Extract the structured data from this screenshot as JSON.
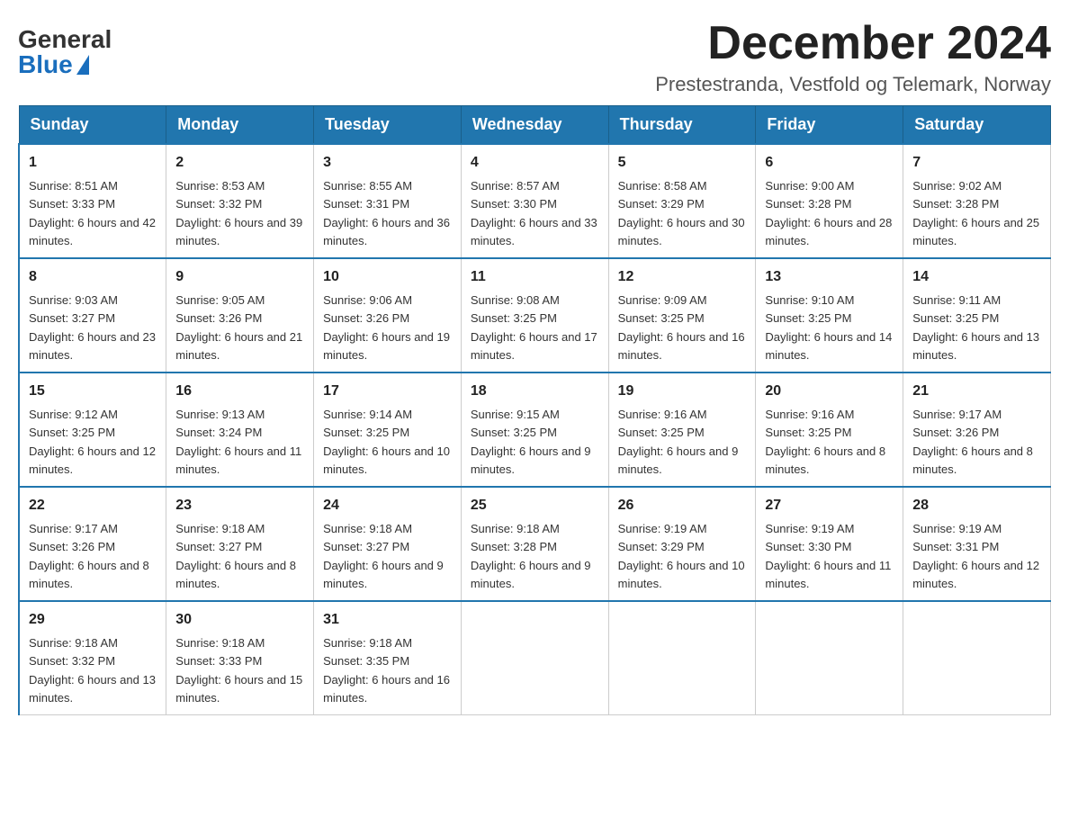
{
  "logo": {
    "general": "General",
    "blue": "Blue"
  },
  "title": "December 2024",
  "subtitle": "Prestestranda, Vestfold og Telemark, Norway",
  "days_of_week": [
    "Sunday",
    "Monday",
    "Tuesday",
    "Wednesday",
    "Thursday",
    "Friday",
    "Saturday"
  ],
  "weeks": [
    [
      {
        "day": "1",
        "sunrise": "Sunrise: 8:51 AM",
        "sunset": "Sunset: 3:33 PM",
        "daylight": "Daylight: 6 hours and 42 minutes."
      },
      {
        "day": "2",
        "sunrise": "Sunrise: 8:53 AM",
        "sunset": "Sunset: 3:32 PM",
        "daylight": "Daylight: 6 hours and 39 minutes."
      },
      {
        "day": "3",
        "sunrise": "Sunrise: 8:55 AM",
        "sunset": "Sunset: 3:31 PM",
        "daylight": "Daylight: 6 hours and 36 minutes."
      },
      {
        "day": "4",
        "sunrise": "Sunrise: 8:57 AM",
        "sunset": "Sunset: 3:30 PM",
        "daylight": "Daylight: 6 hours and 33 minutes."
      },
      {
        "day": "5",
        "sunrise": "Sunrise: 8:58 AM",
        "sunset": "Sunset: 3:29 PM",
        "daylight": "Daylight: 6 hours and 30 minutes."
      },
      {
        "day": "6",
        "sunrise": "Sunrise: 9:00 AM",
        "sunset": "Sunset: 3:28 PM",
        "daylight": "Daylight: 6 hours and 28 minutes."
      },
      {
        "day": "7",
        "sunrise": "Sunrise: 9:02 AM",
        "sunset": "Sunset: 3:28 PM",
        "daylight": "Daylight: 6 hours and 25 minutes."
      }
    ],
    [
      {
        "day": "8",
        "sunrise": "Sunrise: 9:03 AM",
        "sunset": "Sunset: 3:27 PM",
        "daylight": "Daylight: 6 hours and 23 minutes."
      },
      {
        "day": "9",
        "sunrise": "Sunrise: 9:05 AM",
        "sunset": "Sunset: 3:26 PM",
        "daylight": "Daylight: 6 hours and 21 minutes."
      },
      {
        "day": "10",
        "sunrise": "Sunrise: 9:06 AM",
        "sunset": "Sunset: 3:26 PM",
        "daylight": "Daylight: 6 hours and 19 minutes."
      },
      {
        "day": "11",
        "sunrise": "Sunrise: 9:08 AM",
        "sunset": "Sunset: 3:25 PM",
        "daylight": "Daylight: 6 hours and 17 minutes."
      },
      {
        "day": "12",
        "sunrise": "Sunrise: 9:09 AM",
        "sunset": "Sunset: 3:25 PM",
        "daylight": "Daylight: 6 hours and 16 minutes."
      },
      {
        "day": "13",
        "sunrise": "Sunrise: 9:10 AM",
        "sunset": "Sunset: 3:25 PM",
        "daylight": "Daylight: 6 hours and 14 minutes."
      },
      {
        "day": "14",
        "sunrise": "Sunrise: 9:11 AM",
        "sunset": "Sunset: 3:25 PM",
        "daylight": "Daylight: 6 hours and 13 minutes."
      }
    ],
    [
      {
        "day": "15",
        "sunrise": "Sunrise: 9:12 AM",
        "sunset": "Sunset: 3:25 PM",
        "daylight": "Daylight: 6 hours and 12 minutes."
      },
      {
        "day": "16",
        "sunrise": "Sunrise: 9:13 AM",
        "sunset": "Sunset: 3:24 PM",
        "daylight": "Daylight: 6 hours and 11 minutes."
      },
      {
        "day": "17",
        "sunrise": "Sunrise: 9:14 AM",
        "sunset": "Sunset: 3:25 PM",
        "daylight": "Daylight: 6 hours and 10 minutes."
      },
      {
        "day": "18",
        "sunrise": "Sunrise: 9:15 AM",
        "sunset": "Sunset: 3:25 PM",
        "daylight": "Daylight: 6 hours and 9 minutes."
      },
      {
        "day": "19",
        "sunrise": "Sunrise: 9:16 AM",
        "sunset": "Sunset: 3:25 PM",
        "daylight": "Daylight: 6 hours and 9 minutes."
      },
      {
        "day": "20",
        "sunrise": "Sunrise: 9:16 AM",
        "sunset": "Sunset: 3:25 PM",
        "daylight": "Daylight: 6 hours and 8 minutes."
      },
      {
        "day": "21",
        "sunrise": "Sunrise: 9:17 AM",
        "sunset": "Sunset: 3:26 PM",
        "daylight": "Daylight: 6 hours and 8 minutes."
      }
    ],
    [
      {
        "day": "22",
        "sunrise": "Sunrise: 9:17 AM",
        "sunset": "Sunset: 3:26 PM",
        "daylight": "Daylight: 6 hours and 8 minutes."
      },
      {
        "day": "23",
        "sunrise": "Sunrise: 9:18 AM",
        "sunset": "Sunset: 3:27 PM",
        "daylight": "Daylight: 6 hours and 8 minutes."
      },
      {
        "day": "24",
        "sunrise": "Sunrise: 9:18 AM",
        "sunset": "Sunset: 3:27 PM",
        "daylight": "Daylight: 6 hours and 9 minutes."
      },
      {
        "day": "25",
        "sunrise": "Sunrise: 9:18 AM",
        "sunset": "Sunset: 3:28 PM",
        "daylight": "Daylight: 6 hours and 9 minutes."
      },
      {
        "day": "26",
        "sunrise": "Sunrise: 9:19 AM",
        "sunset": "Sunset: 3:29 PM",
        "daylight": "Daylight: 6 hours and 10 minutes."
      },
      {
        "day": "27",
        "sunrise": "Sunrise: 9:19 AM",
        "sunset": "Sunset: 3:30 PM",
        "daylight": "Daylight: 6 hours and 11 minutes."
      },
      {
        "day": "28",
        "sunrise": "Sunrise: 9:19 AM",
        "sunset": "Sunset: 3:31 PM",
        "daylight": "Daylight: 6 hours and 12 minutes."
      }
    ],
    [
      {
        "day": "29",
        "sunrise": "Sunrise: 9:18 AM",
        "sunset": "Sunset: 3:32 PM",
        "daylight": "Daylight: 6 hours and 13 minutes."
      },
      {
        "day": "30",
        "sunrise": "Sunrise: 9:18 AM",
        "sunset": "Sunset: 3:33 PM",
        "daylight": "Daylight: 6 hours and 15 minutes."
      },
      {
        "day": "31",
        "sunrise": "Sunrise: 9:18 AM",
        "sunset": "Sunset: 3:35 PM",
        "daylight": "Daylight: 6 hours and 16 minutes."
      },
      null,
      null,
      null,
      null
    ]
  ]
}
